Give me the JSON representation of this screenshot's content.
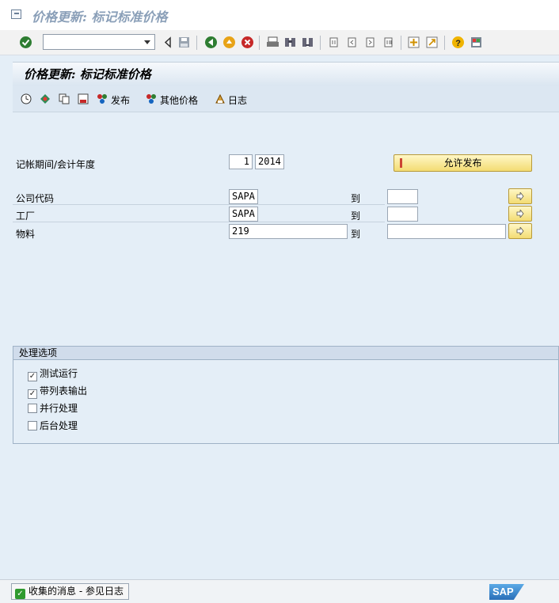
{
  "window": {
    "title": "价格更新: 标记标准价格"
  },
  "screen": {
    "header_title": "价格更新: 标记标准价格"
  },
  "app_toolbar": {
    "release_label": "发布",
    "other_prices_label": "其他价格",
    "log_label": "日志"
  },
  "form": {
    "period_label": "记帐期间/会计年度",
    "period_value": "1",
    "fiscal_year_value": "2014",
    "allow_release_button": "允许发布",
    "company_code_label": "公司代码",
    "company_code_value": "SAPA",
    "plant_label": "工厂",
    "plant_value": "SAPA",
    "material_label": "物料",
    "material_value": "219",
    "to_label": "到"
  },
  "options": {
    "title": "处理选项",
    "items": [
      {
        "label": "测试运行",
        "checked": true
      },
      {
        "label": "带列表输出",
        "checked": true
      },
      {
        "label": "并行处理",
        "checked": false
      },
      {
        "label": "后台处理",
        "checked": false
      }
    ]
  },
  "status": {
    "message": "收集的消息 - 参见日志"
  },
  "colors": {
    "background": "#e4eef7",
    "header_gradient_top": "#f6f9fc",
    "button_yellow": "#f3dc73",
    "ok_green": "#2f9a2f"
  }
}
